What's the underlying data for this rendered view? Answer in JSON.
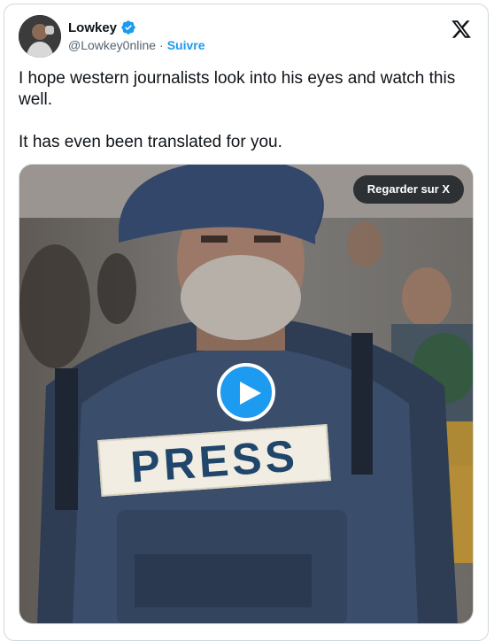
{
  "tweet": {
    "display_name": "Lowkey",
    "handle": "@Lowkey0nline",
    "separator": "·",
    "follow_label": "Suivre",
    "text_line1": "I hope western journalists look into his eyes and watch this well.",
    "text_line2": "It has even been translated for you."
  },
  "media": {
    "watch_label": "Regarder sur X",
    "vest_label": "PRESS"
  },
  "icons": {
    "verified": "verified-badge-icon",
    "platform": "x-logo-icon",
    "play": "play-icon"
  },
  "colors": {
    "accent": "#1d9bf0",
    "text": "#0f1419",
    "muted": "#536471"
  }
}
